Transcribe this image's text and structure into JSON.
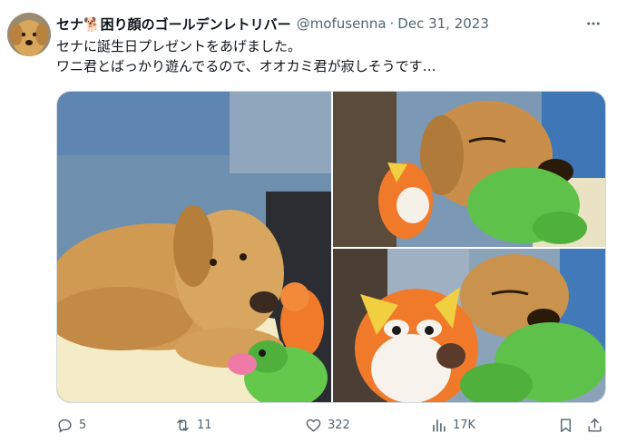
{
  "user": {
    "display_name": "セナ🐕困り顔のゴールデンレトリバー",
    "handle": "@mofusenna",
    "separator": "·",
    "date": "Dec 31, 2023"
  },
  "tweet": {
    "lines": [
      "セナに誕生日プレゼントをあげました。",
      "ワニ君とばっかり遊んでるので、オオカミ君が寂しそうです…"
    ]
  },
  "actions": {
    "replies": "5",
    "retweets": "11",
    "likes": "322",
    "views": "17K"
  },
  "icons": {
    "more": "more-icon",
    "reply": "reply-icon",
    "retweet": "retweet-icon",
    "like": "heart-icon",
    "views": "views-icon",
    "bookmark": "bookmark-icon",
    "share": "share-icon"
  },
  "colors": {
    "text": "#0f1419",
    "secondary": "#536471",
    "border": "#cfd9de"
  }
}
